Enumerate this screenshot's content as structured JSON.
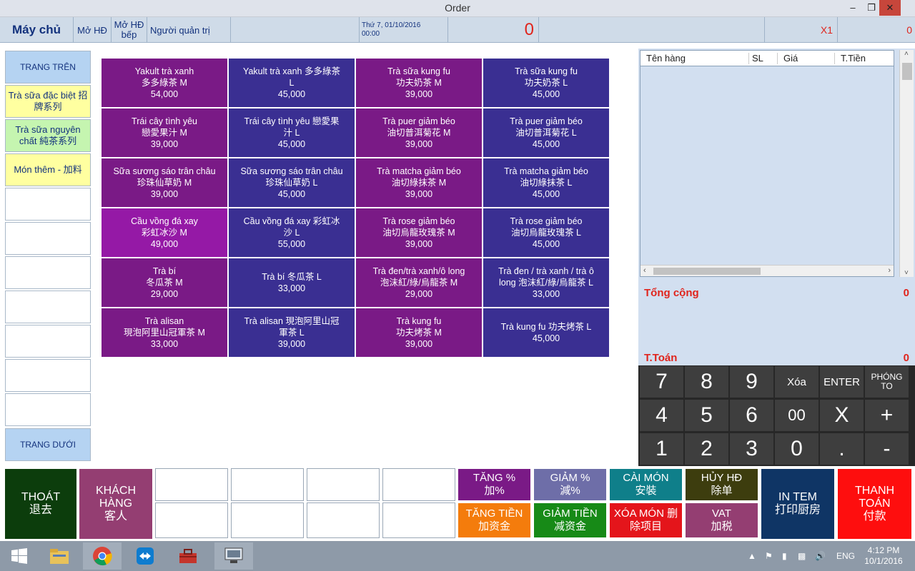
{
  "window": {
    "title": "Order"
  },
  "infobar": {
    "host": "Máy chủ",
    "open_invoice": "Mở HĐ",
    "open_kitchen_l1": "Mở HĐ",
    "open_kitchen_l2": "bếp",
    "user": "Người quản trị",
    "date": "Thứ 7, 01/10/2016",
    "time": "00:00",
    "total": "0",
    "multiplier": "X1",
    "right_value": "0"
  },
  "categories": [
    {
      "label": "TRANG TRÊN",
      "style": "nav"
    },
    {
      "label": "Trà sữa đặc biệt 招牌系列",
      "style": "yellow"
    },
    {
      "label": "Trà sữa nguyên chất 純茶系列",
      "style": "green"
    },
    {
      "label": "Món thêm - 加料",
      "style": "yellow"
    },
    {
      "label": "",
      "style": "empty"
    },
    {
      "label": "",
      "style": "empty"
    },
    {
      "label": "",
      "style": "empty"
    },
    {
      "label": "",
      "style": "empty"
    },
    {
      "label": "",
      "style": "empty"
    },
    {
      "label": "",
      "style": "empty"
    },
    {
      "label": "",
      "style": "empty"
    },
    {
      "label": "TRANG DƯỚI",
      "style": "nav"
    }
  ],
  "menu_items": [
    {
      "name": "Yakult trà xanh",
      "name2": "多多綠茶 M",
      "price": "54,000",
      "color": "#7a1a86"
    },
    {
      "name": "Yakult trà xanh 多多綠茶",
      "name2": "L",
      "price": "45,000",
      "color": "#3a2f92"
    },
    {
      "name": "Trà sữa kung fu",
      "name2": "功夫奶茶 M",
      "price": "39,000",
      "color": "#7a1a86"
    },
    {
      "name": "Trà sữa kung fu",
      "name2": "功夫奶茶 L",
      "price": "45,000",
      "color": "#3a2f92"
    },
    {
      "name": "Trái cây tình yêu",
      "name2": "戀愛果汁 M",
      "price": "39,000",
      "color": "#7a1a86"
    },
    {
      "name": "Trái cây tình yêu 戀愛果",
      "name2": "汁 L",
      "price": "45,000",
      "color": "#3a2f92"
    },
    {
      "name": "Trà puer giảm béo",
      "name2": "油切普洱菊花 M",
      "price": "39,000",
      "color": "#7a1a86"
    },
    {
      "name": "Trà puer giảm béo",
      "name2": "油切普洱菊花 L",
      "price": "45,000",
      "color": "#3a2f92"
    },
    {
      "name": "Sữa sương sáo trân châu",
      "name2": "珍珠仙草奶 M",
      "price": "39,000",
      "color": "#7a1a86"
    },
    {
      "name": "Sữa sương sáo trân châu",
      "name2": "珍珠仙草奶 L",
      "price": "45,000",
      "color": "#3a2f92"
    },
    {
      "name": "Trà matcha giảm béo",
      "name2": "油切綠抹茶 M",
      "price": "39,000",
      "color": "#7a1a86"
    },
    {
      "name": "Trà matcha giảm béo",
      "name2": "油切綠抹茶 L",
      "price": "45,000",
      "color": "#3a2f92"
    },
    {
      "name": "Cầu vồng đá xay",
      "name2": "彩虹冰沙 M",
      "price": "49,000",
      "color": "#9519a6"
    },
    {
      "name": "Cầu vồng đá xay 彩虹冰",
      "name2": "沙 L",
      "price": "55,000",
      "color": "#3a2f92"
    },
    {
      "name": "Trà rose giảm béo",
      "name2": "油切烏龍玫瑰茶 M",
      "price": "39,000",
      "color": "#7a1a86"
    },
    {
      "name": "Trà rose giảm béo",
      "name2": "油切烏龍玫瑰茶 L",
      "price": "45,000",
      "color": "#3a2f92"
    },
    {
      "name": "Trà bí",
      "name2": "冬瓜茶 M",
      "price": "29,000",
      "color": "#7a1a86"
    },
    {
      "name": "Trà bí 冬瓜茶 L",
      "name2": "",
      "price": "33,000",
      "color": "#3a2f92"
    },
    {
      "name": "Trà đen/trà xanh/ô long",
      "name2": "泡沫紅/綠/烏龍茶 M",
      "price": "29,000",
      "color": "#7a1a86"
    },
    {
      "name": "Trà đen / trà xanh / trà ô",
      "name2": "long 泡沫紅/綠/烏龍茶 L",
      "price": "33,000",
      "color": "#3a2f92"
    },
    {
      "name": "Trà alisan",
      "name2": "現泡阿里山冠軍茶 M",
      "price": "33,000",
      "color": "#7a1a86"
    },
    {
      "name": "Trà alisan 現泡阿里山冠",
      "name2": "軍茶 L",
      "price": "39,000",
      "color": "#3a2f92"
    },
    {
      "name": "Trà kung fu",
      "name2": "功夫烤茶 M",
      "price": "39,000",
      "color": "#7a1a86"
    },
    {
      "name": "Trà kung fu 功夫烤茶 L",
      "name2": "",
      "price": "45,000",
      "color": "#3a2f92"
    }
  ],
  "order_table": {
    "columns": [
      "Tên hàng",
      "SL",
      "Giá",
      "T.Tiền"
    ],
    "rows": []
  },
  "totals": {
    "total_label": "Tổng cộng",
    "total_value": "0",
    "pay_label": "T.Toán",
    "pay_value": "0"
  },
  "keypad": [
    "7",
    "8",
    "9",
    "Xóa",
    "ENTER",
    "PHÓNG TO",
    "4",
    "5",
    "6",
    "00",
    "X",
    "+",
    "1",
    "2",
    "3",
    "0",
    ".",
    "-"
  ],
  "actions": {
    "exit_l1": "THOÁT",
    "exit_l2": "退去",
    "customer_l1": "KHÁCH",
    "customer_l2": "HÀNG",
    "customer_l3": "客人",
    "inc_pct_l1": "TĂNG %",
    "inc_pct_l2": "加%",
    "dec_pct_l1": "GIẢM %",
    "dec_pct_l2": "減%",
    "setup_l1": "CÀI MÓN",
    "setup_l2": "安裝",
    "cancel_l1": "HỦY HĐ",
    "cancel_l2": "除单",
    "inc_amt_l1": "TĂNG TIỀN",
    "inc_amt_l2": "加资金",
    "dec_amt_l1": "GIẢM TIỀN",
    "dec_amt_l2": "减资金",
    "delete_l1": "XÓA MÓN 删",
    "delete_l2": "除项目",
    "vat_l1": "VAT",
    "vat_l2": "加税",
    "print_l1": "IN TEM",
    "print_l2": "打印厨房",
    "pay_l1": "THANH",
    "pay_l2": "TOÁN",
    "pay_l3": "付款"
  },
  "taskbar": {
    "language": "ENG",
    "time": "4:12 PM",
    "date": "10/1/2016"
  },
  "colors": {
    "accent_red": "#e0241c",
    "header_bg": "#cfdbe8",
    "item_purple": "#7a1a86",
    "item_blue": "#3a2f92",
    "keypad_bg": "#272727"
  }
}
